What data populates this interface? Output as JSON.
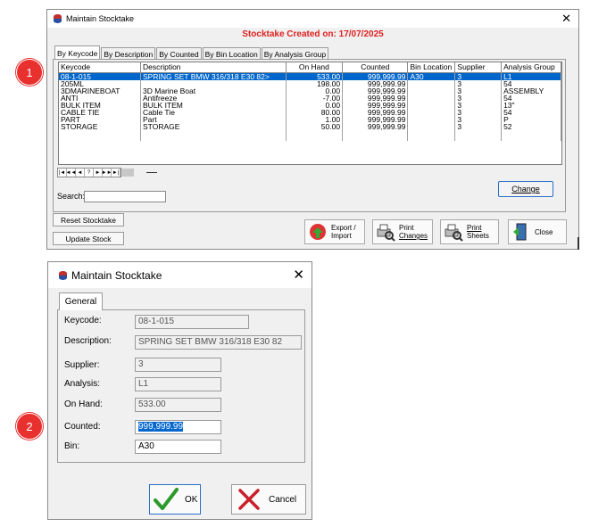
{
  "badges": [
    "1",
    "2"
  ],
  "window1": {
    "title": "Maintain Stocktake",
    "subtitle": "Stocktake Created on: 17/07/2025",
    "close_icon": "close-icon",
    "tabs": [
      "By Keycode",
      "By Description",
      "By Counted",
      "By Bin Location",
      "By Analysis Group"
    ],
    "columns": [
      "Keycode",
      "Description",
      "On Hand",
      "Counted",
      "Bin Location",
      "Supplier",
      "Analysis Group"
    ],
    "rows": [
      [
        "08-1-015",
        "SPRING SET BMW 316/318 E30 82>",
        "533.00",
        "999,999.99",
        "A30",
        "3",
        "L1"
      ],
      [
        "205ML",
        "",
        "198.00",
        "999,999.99",
        "",
        "3",
        "54"
      ],
      [
        "3DMARINEBOAT",
        "3D Marine Boat",
        "0.00",
        "999,999.99",
        "",
        "3",
        "ASSEMBLY"
      ],
      [
        "ANTI",
        "Antifreeze",
        "-7.00",
        "999,999.99",
        "",
        "3",
        "54"
      ],
      [
        "BULK ITEM",
        "BULK ITEM",
        "0.00",
        "999,999.99",
        "",
        "3",
        "13\""
      ],
      [
        "CABLE TIE",
        "Cable Tie",
        "80.00",
        "999,999.99",
        "",
        "3",
        "54"
      ],
      [
        "PART",
        "Part",
        "1.00",
        "999,999.99",
        "",
        "3",
        "P"
      ],
      [
        "STORAGE",
        "STORAGE",
        "50.00",
        "999,999.99",
        "",
        "3",
        "52"
      ]
    ],
    "selected_row": 0,
    "nav_buttons": [
      "|◄",
      "◄◄",
      "◄",
      "?",
      "►",
      "►►",
      "►|"
    ],
    "search_label": "Search:",
    "search_value": "",
    "change_label": "Change",
    "reset_label": "Reset Stocktake",
    "update_label": "Update Stock",
    "export_label_1": "Export /",
    "export_label_2": "Import",
    "print_changes_1": "Print",
    "print_changes_2": "Changes",
    "print_sheets_1": "Print",
    "print_sheets_2": "Sheets",
    "close_label": "Close"
  },
  "window2": {
    "title": "Maintain Stocktake",
    "close_icon": "close-icon",
    "tab": "General",
    "fields": {
      "keycode_label": "Keycode:",
      "keycode": "08-1-015",
      "description_label": "Description:",
      "description": "SPRING SET BMW 316/318 E30 82",
      "supplier_label": "Supplier:",
      "supplier": "3",
      "analysis_label": "Analysis:",
      "analysis": "L1",
      "onhand_label": "On Hand:",
      "onhand": "533.00",
      "counted_label": "Counted:",
      "counted": "999,999.99",
      "bin_label": "Bin:",
      "bin": "A30"
    },
    "ok_label": "OK",
    "cancel_label": "Cancel"
  },
  "colors": {
    "badge": "#e8302e",
    "selection": "#0066cc",
    "subtitle": "#e02020",
    "accent_border": "#2a6fc9"
  }
}
